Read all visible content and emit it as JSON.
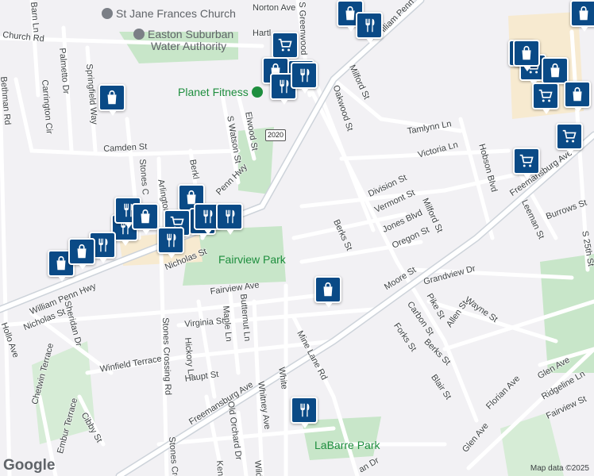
{
  "streets": {
    "norton_ave": "Norton Ave",
    "barn_ln": "Barn Ln",
    "church_rd": "Church Rd",
    "hartley": "Hartl",
    "palmetto_dr": "Palmetto Dr",
    "carrington_cir": "Carrington Cir",
    "springfield_way": "Springfield Way",
    "bethman_rd": "Bethman Rd",
    "camden_st": "Camden St",
    "stones_c": "Stones C",
    "arlington": "Arlington",
    "berkl": "Berkl",
    "s_watson_st": "S Watson St",
    "elwood_st": "Elwood St",
    "s_greenwood": "S Greenwood",
    "wm_penn_hwy_ne": "William Penn Hwy",
    "wm_penn_hwy_mid": "Penn Hwy",
    "wm_penn_hwy_sw": "William Penn Hwy",
    "oakwood_st": "Oakwood St",
    "milford_st_n": "Milford St",
    "tamlynn_ln": "Tamlynn Ln",
    "victoria_ln": "Victoria Ln",
    "hobson_blvd": "Hobson Blvd",
    "division_st": "Division St",
    "vermont_st": "Vermont St",
    "jones_blvd": "Jones Blvd",
    "oregon_st": "Oregon St",
    "milford_st_s": "Milford St",
    "berks_st_n": "Berks St",
    "freemansburg_ave_ne": "Freemansburg Ave",
    "freemansburg_ave_sw": "Freemansburg Ave",
    "leeman_st": "Leeman St",
    "burrows_st": "Burrows St",
    "s_25th_st": "S 25th St",
    "nicholas_st_n": "Nicholas St",
    "nicholas_st_w": "Nicholas St",
    "fairview_ave": "Fairview Ave",
    "moore_st": "Moore St",
    "grandview_dr": "Grandview Dr",
    "pike_st": "Pike St",
    "carbon_st": "Carbon St",
    "wayne_st": "Wayne St",
    "allen_st": "Allen St",
    "forks_st": "Forks St",
    "berks_st_s": "Berks St",
    "sheridan_dr": "Sheridan Dr",
    "hollo_ave": "Hollo Ave",
    "virginia_st": "Virginia St",
    "butternut_ln": "Butternut Ln",
    "maple_ln": "Maple Ln",
    "hickory_ln": "Hickory Ln",
    "stones_crossing_rd": "Stones Crossing Rd",
    "winfield_terrace": "Winfield Terrace",
    "haupt_st": "Haupt St",
    "old_orchard_dr": "Old Orchard Dr",
    "mine_lane_rd": "Mine Lane Rd",
    "whitney_ave": "Whitney Ave",
    "white": "White",
    "blair_st": "Blair St",
    "florian_ave": "Florian Ave",
    "glen_ave_ne": "Glen Ave",
    "glen_ave_s": "Glen Ave",
    "ridgeline_ln": "Ridgeline Ln",
    "fairview_st": "Fairview St",
    "chetwin_terrace": "Chetwin Terrace",
    "embur_terrace": "Embur Terrace",
    "cibby_st": "Cibby St",
    "stones_cro": "Stones Cro",
    "ken": "Ken",
    "wild": "Wild",
    "dan_dr": "an Dr"
  },
  "pois": {
    "church": "St Jane Frances Church",
    "water_authority_1": "Easton Suburban",
    "water_authority_2": "Water Authority",
    "planet_fitness": "Planet Fitness",
    "fairview_park": "Fairview Park",
    "labarre_park": "LaBarre Park"
  },
  "route_shield": "2020",
  "attribution": "Map data ©2025",
  "logo": "Google",
  "colors": {
    "marker": "#0a4a86",
    "park": "#c8e6c9",
    "commercial": "#f7ead0",
    "road": "#ffffff",
    "highway": "#cdd3da"
  },
  "markers": [
    {
      "type": "shopping-bag"
    },
    {
      "type": "restaurant"
    },
    {
      "type": "shopping-cart"
    },
    {
      "type": "shopping-bag"
    },
    {
      "type": "restaurant"
    },
    {
      "type": "restaurant"
    },
    {
      "type": "shopping-bag"
    },
    {
      "type": "shopping-bag"
    },
    {
      "type": "shopping-cart"
    },
    {
      "type": "shopping-bag"
    },
    {
      "type": "shopping-cart"
    },
    {
      "type": "shopping-bag"
    },
    {
      "type": "shopping-cart"
    },
    {
      "type": "shopping-cart"
    },
    {
      "type": "shopping-bag"
    },
    {
      "type": "restaurant"
    },
    {
      "type": "shopping-bag"
    },
    {
      "type": "shopping-bag"
    },
    {
      "type": "shopping-cart"
    },
    {
      "type": "restaurant"
    },
    {
      "type": "restaurant"
    },
    {
      "type": "shopping-cart"
    },
    {
      "type": "restaurant"
    },
    {
      "type": "restaurant"
    },
    {
      "type": "shopping-bag"
    },
    {
      "type": "restaurant"
    },
    {
      "type": "restaurant"
    },
    {
      "type": "shopping-bag"
    },
    {
      "type": "shopping-bag"
    },
    {
      "type": "shopping-bag"
    },
    {
      "type": "restaurant"
    }
  ]
}
